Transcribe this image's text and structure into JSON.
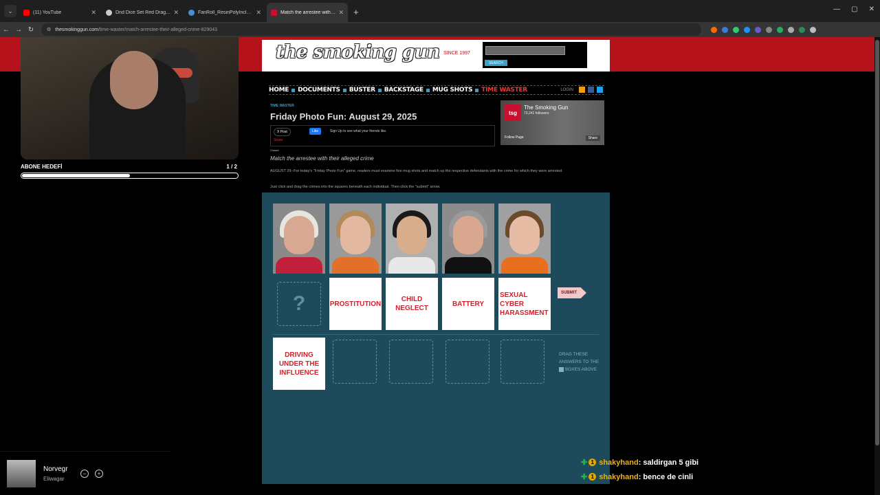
{
  "browser": {
    "tabs": [
      {
        "title": "(11) YouTube",
        "color": "#ff0000",
        "active": false
      },
      {
        "title": "Dnd Dice Set Red Dragon drag",
        "color": "#cccccc",
        "active": false
      },
      {
        "title": "FanRoll_ResinPolyInclusionDice",
        "color": "#4a90d9",
        "active": false
      },
      {
        "title": "Match the arrestee with their a",
        "color": "#c8102e",
        "active": true
      }
    ],
    "url_host": "thesmokinggun.com",
    "url_path": "/time-waster/match-arrestee-their-alleged-crime-829043",
    "new_tab": "+",
    "back": "←",
    "forward": "→",
    "reload": "↻"
  },
  "stream": {
    "subgoal_label": "ABONE HEDEFİ",
    "subgoal_count": "1 / 2",
    "subgoal_progress": 0.5
  },
  "site": {
    "logo_text": "the smoking gun",
    "since": "SINCE 1997",
    "search_btn": "SEARCH",
    "nav": [
      {
        "label": "HOME",
        "active": false
      },
      {
        "label": "DOCUMENTS",
        "active": false
      },
      {
        "label": "BUSTER",
        "active": false
      },
      {
        "label": "BACKSTAGE",
        "active": false
      },
      {
        "label": "MUG SHOTS",
        "active": false
      },
      {
        "label": "TIME WASTER",
        "active": true
      }
    ],
    "login": "LOGIN"
  },
  "article": {
    "kicker": "TIME WASTER",
    "headline": "Friday Photo Fun: August 29, 2025",
    "xpost": "X Post",
    "fb_like": "Like",
    "fb_text": "Sign Up to see what your friends like.",
    "share": "Share",
    "closed": "Closed",
    "subtitle": "Match the arrestee with their alleged crime",
    "body1": "AUGUST 29--For today's \"Friday Photo Fun\" game, readers must examine five mug shots and match up the respective defendants with the crime for which they were arrested.",
    "body2": "Just click and drag the crimes into the squares beneath each individual. Then click the \"submit\" arrow."
  },
  "fbcard": {
    "logo": "tsg",
    "name": "The Smoking Gun",
    "followers": "73,241 followers",
    "follow": "Follow Page",
    "share": "Share"
  },
  "game": {
    "mugs": [
      {
        "skin": "#d9a893",
        "hair": "#e8e4de",
        "shirt": "#c0203a",
        "bg": "#8a8a8a"
      },
      {
        "skin": "#e3b8a0",
        "hair": "#b08a5a",
        "shirt": "#e2702a",
        "bg": "#9a9a9a"
      },
      {
        "skin": "#d8ad8c",
        "hair": "#1a1a1a",
        "shirt": "#e8e8e8",
        "bg": "#b0b0b0"
      },
      {
        "skin": "#d9a78f",
        "hair": "#9a9a9a",
        "shirt": "#111111",
        "bg": "#8c8c8c"
      },
      {
        "skin": "#e6bca4",
        "hair": "#6a4a2a",
        "shirt": "#e86f1e",
        "bg": "#a0a0a0"
      }
    ],
    "slot_question": "?",
    "placed": [
      "PROSTITUTION",
      "CHILD NEGLECT",
      "BATTERY",
      "SEXUAL CYBER HARASSMENT"
    ],
    "submit": "SUBMIT",
    "answers": [
      "DRIVING UNDER THE INFLUENCE"
    ],
    "drag_hint_1": "DRAG THESE ANSWERS TO THE",
    "drag_hint_2": "BOXES ABOVE"
  },
  "player": {
    "title": "Norvegr",
    "artist": "Eliwagar",
    "minus": "−",
    "plus": "+"
  },
  "chat": [
    {
      "user": "shakyhand",
      "msg": ": saldirgan 5 gibi",
      "badge": "1"
    },
    {
      "user": "shakyhand",
      "msg": ": bence de cinli",
      "badge": "1"
    }
  ]
}
